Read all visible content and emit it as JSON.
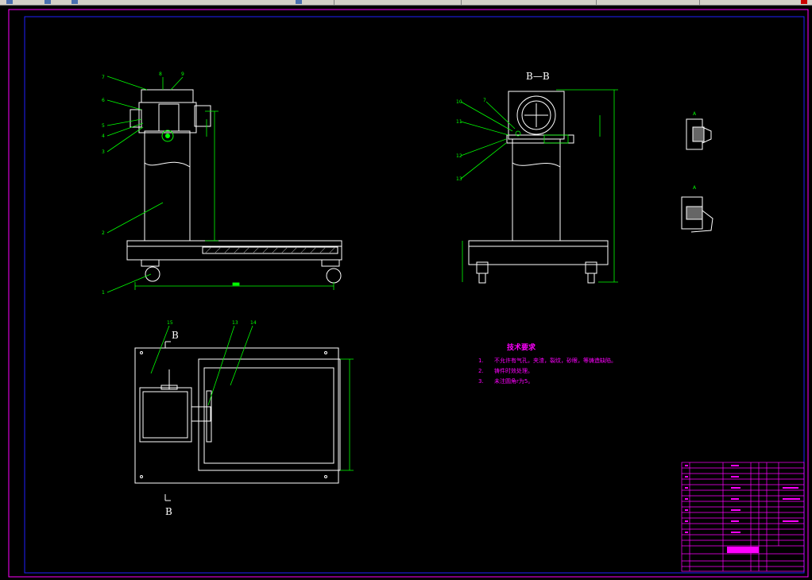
{
  "section_label": "B—B",
  "cut_marker_top": "B",
  "cut_marker_bottom": "B",
  "tech_title": "技术要求",
  "tech_items": [
    {
      "num": "1.",
      "text": "不允许有气孔，夹渣，裂纹，砂眼，等铸造缺陷。"
    },
    {
      "num": "2.",
      "text": "铸件时效处理。"
    },
    {
      "num": "3.",
      "text": "未注圆角r为5。"
    }
  ],
  "front_callouts": [
    "7",
    "8",
    "9",
    "6",
    "5",
    "4",
    "3",
    "2",
    "1"
  ],
  "side_callouts": [
    "10",
    "11",
    "7",
    "12",
    "13"
  ],
  "top_callouts": [
    "15",
    "13",
    "14"
  ],
  "detail_labels": [
    "A",
    "A"
  ],
  "colors": {
    "background": "#000000",
    "border": "#0000ff",
    "part": "#ffffff",
    "leader": "#00ff00",
    "section": "#00ff00",
    "text_tech": "#ff00ff",
    "text_item": "#ff00ff",
    "titleblock": "#ff00ff"
  }
}
